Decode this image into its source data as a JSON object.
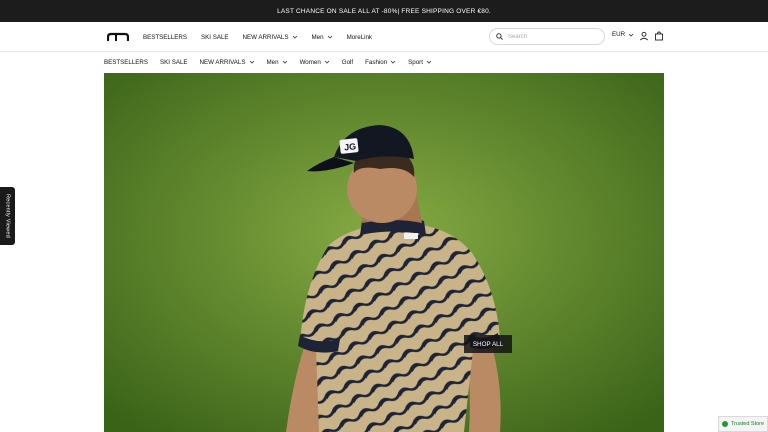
{
  "announcement": {
    "text": "LAST CHANCE ON SALE ALL AT -80%| FREE SHIPPING OVER €80."
  },
  "header": {
    "logo_alt": "J.Lindeberg",
    "nav": [
      {
        "label": "BESTSELLERS",
        "has_dropdown": false
      },
      {
        "label": "SKI SALE",
        "has_dropdown": false
      },
      {
        "label": "NEW ARRIVALS",
        "has_dropdown": true
      },
      {
        "label": "Men",
        "has_dropdown": true
      },
      {
        "label": "MoreLink",
        "has_dropdown": false
      }
    ],
    "search": {
      "placeholder": "Search",
      "value": ""
    },
    "currency": "EUR",
    "icons": [
      "search-icon",
      "user-icon",
      "bag-icon"
    ]
  },
  "subnav": [
    {
      "label": "BESTSELLERS",
      "has_dropdown": false
    },
    {
      "label": "SKI SALE",
      "has_dropdown": false
    },
    {
      "label": "NEW ARRIVALS",
      "has_dropdown": true
    },
    {
      "label": "Men",
      "has_dropdown": true
    },
    {
      "label": "Women",
      "has_dropdown": true
    },
    {
      "label": "Golf",
      "has_dropdown": false
    },
    {
      "label": "Fashion",
      "has_dropdown": true
    },
    {
      "label": "Sport",
      "has_dropdown": true
    }
  ],
  "hero": {
    "cta_label": "SHOP ALL"
  },
  "recently_viewed": {
    "label": "Recently Viewed"
  },
  "trusted_badge": {
    "label": "Trusted Store"
  },
  "colors": {
    "announcement_bg": "#1c1c1c",
    "hero_grass": "#6a9530",
    "cta_bg": "#141414",
    "trusted_green": "#1a9a3a"
  }
}
